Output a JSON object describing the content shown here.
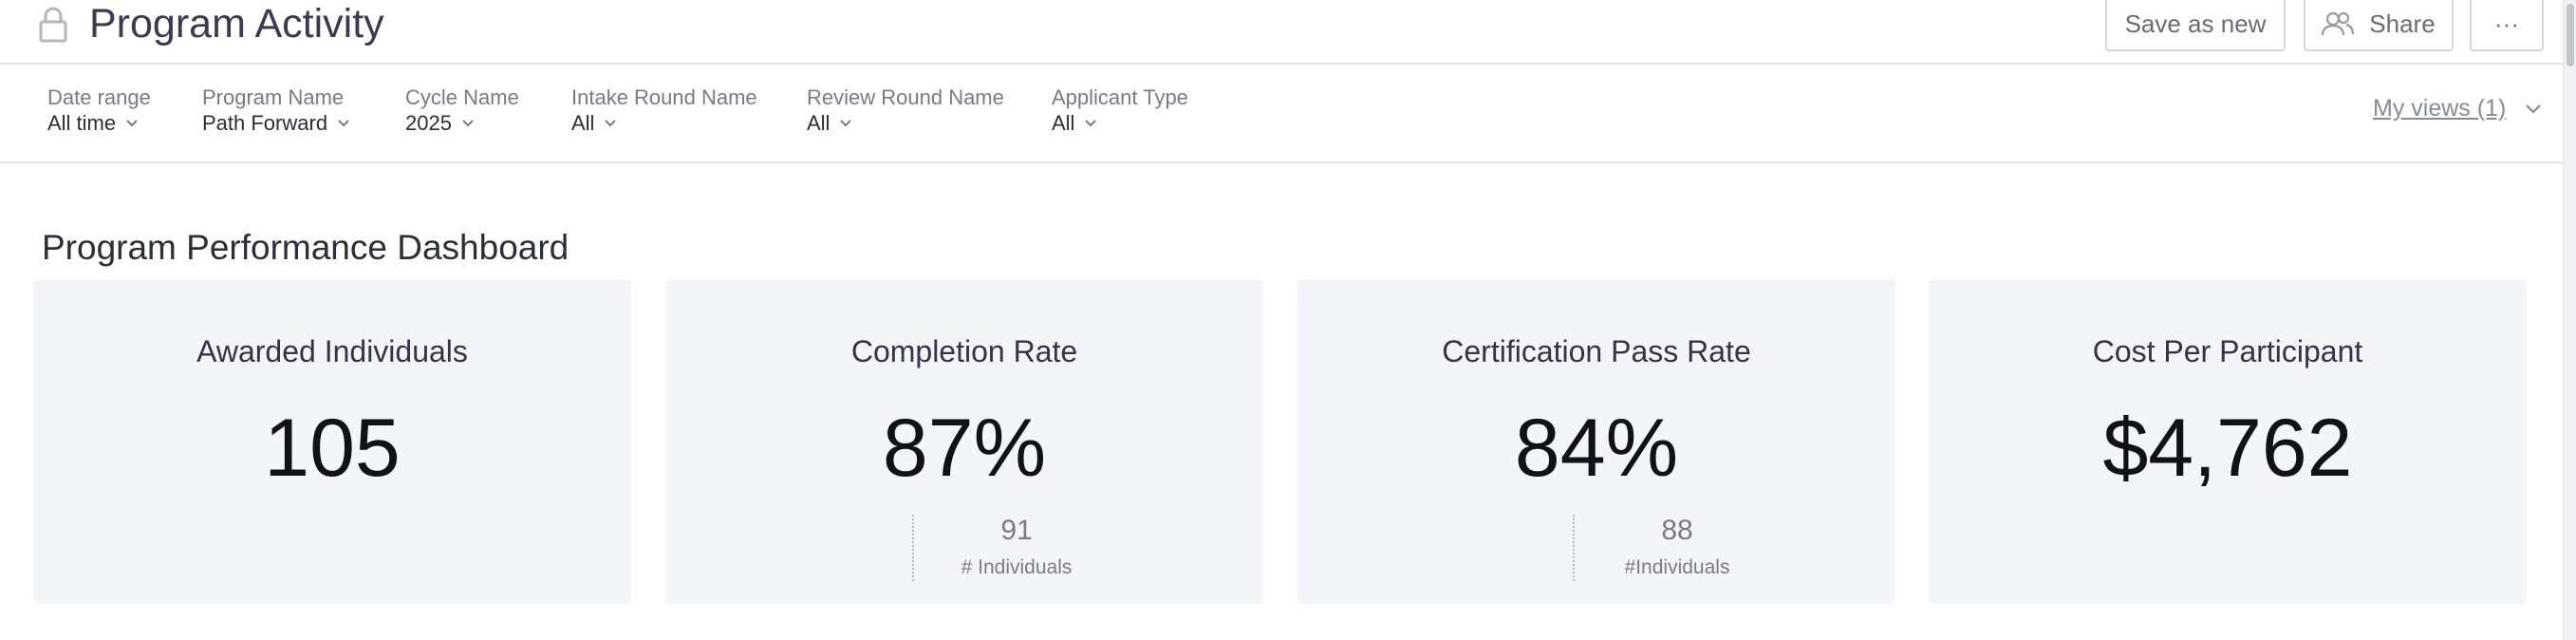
{
  "header": {
    "title": "Program Activity",
    "save_as_new_label": "Save as new",
    "share_label": "Share",
    "more_label": "···"
  },
  "filters": [
    {
      "label": "Date range",
      "value": "All time"
    },
    {
      "label": "Program Name",
      "value": "Path Forward"
    },
    {
      "label": "Cycle Name",
      "value": "2025"
    },
    {
      "label": "Intake Round Name",
      "value": "All"
    },
    {
      "label": "Review Round Name",
      "value": "All"
    },
    {
      "label": "Applicant Type",
      "value": "All"
    }
  ],
  "my_views": {
    "label": "My views (1)"
  },
  "dashboard": {
    "title": "Program Performance Dashboard",
    "cards": [
      {
        "title": "Awarded Individuals",
        "value": "105"
      },
      {
        "title": "Completion Rate",
        "value": "87%",
        "sub_count": "91",
        "sub_label": "# Individuals"
      },
      {
        "title": "Certification Pass Rate",
        "value": "84%",
        "sub_count": "88",
        "sub_label": "#Individuals"
      },
      {
        "title": "Cost Per Participant",
        "value": "$4,762"
      }
    ]
  }
}
